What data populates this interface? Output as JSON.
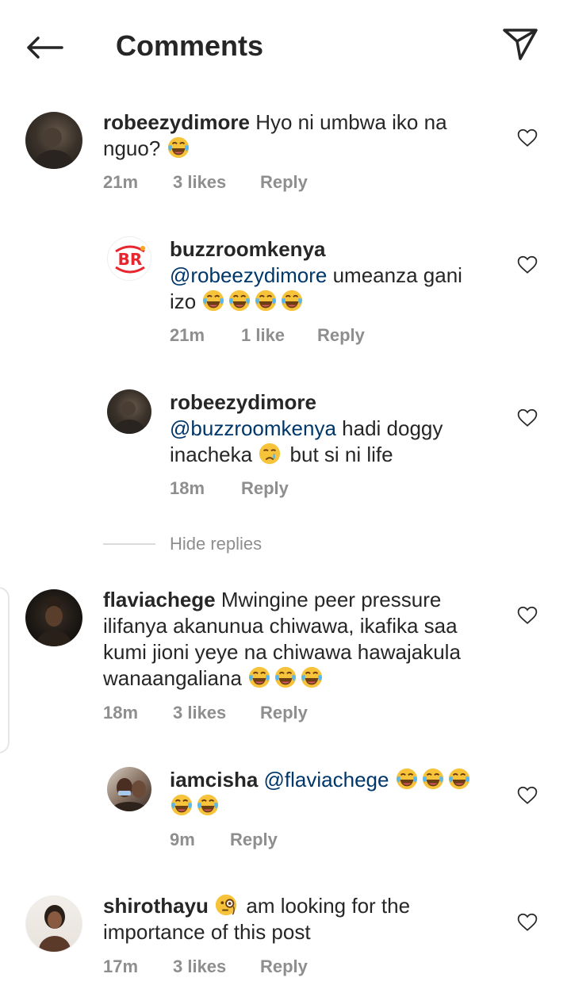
{
  "header": {
    "title": "Comments",
    "back_icon": "arrow-left-icon",
    "send_icon": "paper-plane-icon"
  },
  "comments": [
    {
      "username": "robeezydimore",
      "text_line1": "Hyo ni umbwa iko na",
      "text_line2": "nguo?",
      "time": "21m",
      "likes": "3 likes",
      "reply": "Reply"
    },
    {
      "username": "buzzroomkenya",
      "mention": "@robeezydimore",
      "text_line1_rest": " umeanza gani",
      "text_line2": "izo",
      "time": "21m",
      "likes": "1 like",
      "reply": "Reply",
      "avatar_text": "BR"
    },
    {
      "username": "robeezydimore",
      "mention": "@buzzroomkenya",
      "text_line1_rest": " hadi doggy",
      "text_line2_a": "inacheka",
      "text_line2_b": "but si ni life",
      "time": "18m",
      "reply": "Reply"
    },
    {
      "username": "flaviachege",
      "text_line1": "Mwingine peer pressure",
      "text_line2": "ilifanya akanunua chiwawa, ikafika saa",
      "text_line3": "kumi jioni yeye na chiwawa hawajakula",
      "text_line4": "wanaangaliana",
      "time": "18m",
      "likes": "3 likes",
      "reply": "Reply"
    },
    {
      "username": "iamcisha",
      "mention": "@flaviachege",
      "time": "9m",
      "reply": "Reply"
    },
    {
      "username": "shirothayu",
      "text_line1": "am looking  for the",
      "text_line2": "importance of this post",
      "time": "17m",
      "likes": "3 likes",
      "reply": "Reply"
    }
  ],
  "hide_replies": "Hide replies",
  "colors": {
    "text": "#262626",
    "meta": "#8e8e8e",
    "mention": "#00376b",
    "brand_red": "#e8262e",
    "emoji_yellow": "#f7c33b"
  }
}
